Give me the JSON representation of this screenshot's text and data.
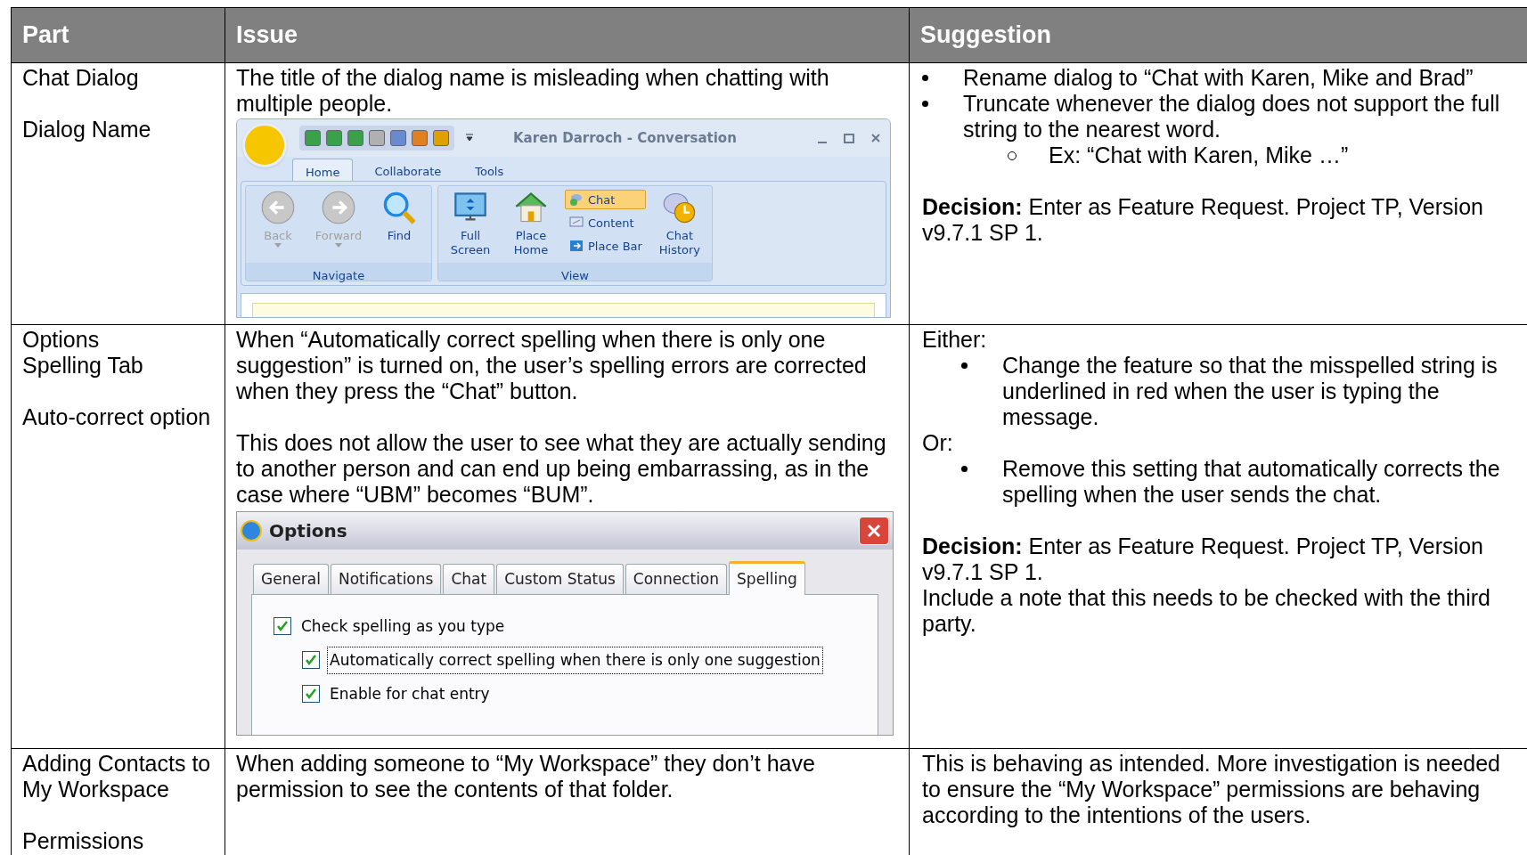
{
  "table": {
    "columns": [
      "Part",
      "Issue",
      "Suggestion"
    ],
    "rows": [
      {
        "part": [
          [
            "Chat Dialog"
          ],
          [
            "Dialog Name"
          ]
        ],
        "issue": {
          "paragraphs": [
            "The title of the dialog name is misleading when chatting with multiple people."
          ],
          "screenshot": {
            "kind": "conversation",
            "title": "Karen Darroch - Conversation",
            "tabs": [
              {
                "label": "Home",
                "selected": true
              },
              {
                "label": "Collaborate",
                "selected": false
              },
              {
                "label": "Tools",
                "selected": false
              }
            ],
            "groups": [
              {
                "label": "Navigate",
                "buttons": [
                  {
                    "kind": "large",
                    "label": "Back",
                    "disabled": true,
                    "dropdown": true
                  },
                  {
                    "kind": "large",
                    "label": "Forward",
                    "disabled": true,
                    "dropdown": true
                  },
                  {
                    "kind": "large",
                    "label": "Find",
                    "disabled": false,
                    "dropdown": false
                  }
                ]
              },
              {
                "label": "View",
                "buttons": [
                  {
                    "kind": "large",
                    "label": "Full Screen",
                    "disabled": false,
                    "dropdown": false
                  },
                  {
                    "kind": "large",
                    "label": "Place Home",
                    "disabled": false,
                    "dropdown": false
                  },
                  {
                    "kind": "stack",
                    "items": [
                      {
                        "label": "Chat",
                        "selected": true
                      },
                      {
                        "label": "Content",
                        "selected": false
                      },
                      {
                        "label": "Place Bar",
                        "selected": false
                      }
                    ]
                  },
                  {
                    "kind": "large",
                    "label": "Chat History",
                    "disabled": false,
                    "dropdown": false
                  }
                ]
              }
            ]
          }
        },
        "suggestion": [
          [
            {
              "kind": "bullet",
              "text": "Rename dialog to “Chat with Karen, Mike and Brad”"
            },
            {
              "kind": "bullet",
              "text": "Truncate whenever the dialog does not support the full string to the nearest word."
            },
            {
              "kind": "subbullet",
              "text": "Ex: “Chat with Karen, Mike …”"
            }
          ],
          [
            {
              "kind": "para",
              "text": "**Decision:** Enter as Feature Request. Project TP, Version v9.7.1 SP 1."
            }
          ]
        ]
      },
      {
        "part": [
          [
            "Options",
            "Spelling Tab"
          ],
          [
            "Auto-correct option"
          ]
        ],
        "issue": {
          "paragraphs": [
            "When “Automatically correct spelling when there is only one suggestion”  is turned on, the user’s spelling errors are corrected when they press the “Chat” button.",
            "This does not allow the user to see what they are actually sending to another person and can end up being embarrassing, as in the case where “UBM” becomes “BUM”."
          ],
          "screenshot": {
            "kind": "options",
            "title": "Options",
            "tabs": [
              {
                "label": "General",
                "selected": false
              },
              {
                "label": "Notifications",
                "selected": false
              },
              {
                "label": "Chat",
                "selected": false
              },
              {
                "label": "Custom Status",
                "selected": false
              },
              {
                "label": "Connection",
                "selected": false
              },
              {
                "label": "Spelling",
                "selected": true
              }
            ],
            "checkboxes": [
              {
                "label": "Check spelling as you type",
                "checked": true,
                "focused": false,
                "children": [
                  {
                    "label": "Automatically correct spelling when there is only one suggestion",
                    "checked": true,
                    "focused": true
                  },
                  {
                    "label": "Enable for chat entry",
                    "checked": true,
                    "focused": false
                  }
                ]
              }
            ]
          }
        },
        "suggestion": [
          [
            {
              "kind": "para",
              "text": "Either:"
            },
            {
              "kind": "bullet2",
              "text": "Change the feature so that the misspelled string is underlined in red when the user is typing the message."
            },
            {
              "kind": "para",
              "text": "Or:"
            },
            {
              "kind": "bullet2",
              "text": "Remove this setting that automatically corrects the spelling when the user sends the chat."
            }
          ],
          [
            {
              "kind": "para",
              "text": "**Decision:** Enter as Feature Request. Project TP, Version v9.7.1 SP 1."
            },
            {
              "kind": "para",
              "text": "Include a note that this needs to be checked with the third party."
            }
          ]
        ]
      },
      {
        "part": [
          [
            "Adding Contacts to My Workspace"
          ],
          [
            "Permissions"
          ]
        ],
        "issue": {
          "paragraphs": [
            "When adding someone to “My Workspace” they don’t have permission to see the contents of that folder."
          ]
        },
        "suggestion": [
          [
            {
              "kind": "para",
              "text": "This is behaving as intended. More investigation is needed to ensure the “My Workspace” permissions are behaving according to the intentions of the users."
            }
          ]
        ]
      }
    ]
  }
}
